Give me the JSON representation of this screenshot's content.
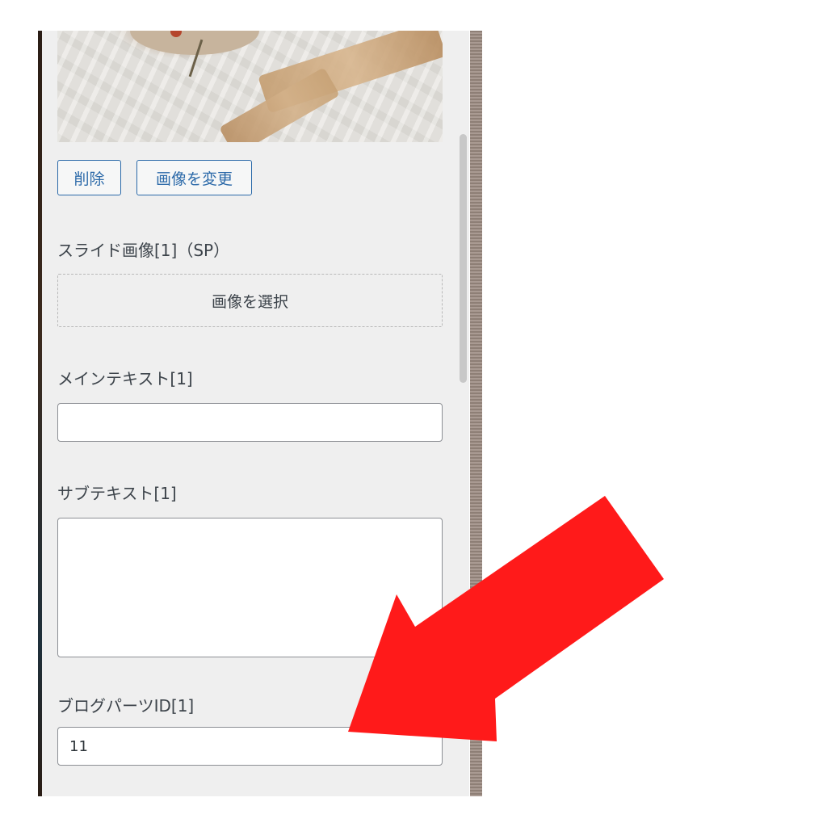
{
  "image_controls": {
    "delete_label": "削除",
    "change_label": "画像を変更"
  },
  "sp_image": {
    "label": "スライド画像[1]（SP）",
    "select_label": "画像を選択"
  },
  "main_text": {
    "label": "メインテキスト[1]",
    "value": ""
  },
  "sub_text": {
    "label": "サブテキスト[1]",
    "value": ""
  },
  "blog_parts": {
    "label": "ブログパーツID[1]",
    "value": "11"
  },
  "colors": {
    "panel_bg": "#efefef",
    "button_accent": "#2c6aa9",
    "arrow": "#ff1a1a"
  },
  "icons": {
    "annotation": "red-arrow-icon"
  }
}
